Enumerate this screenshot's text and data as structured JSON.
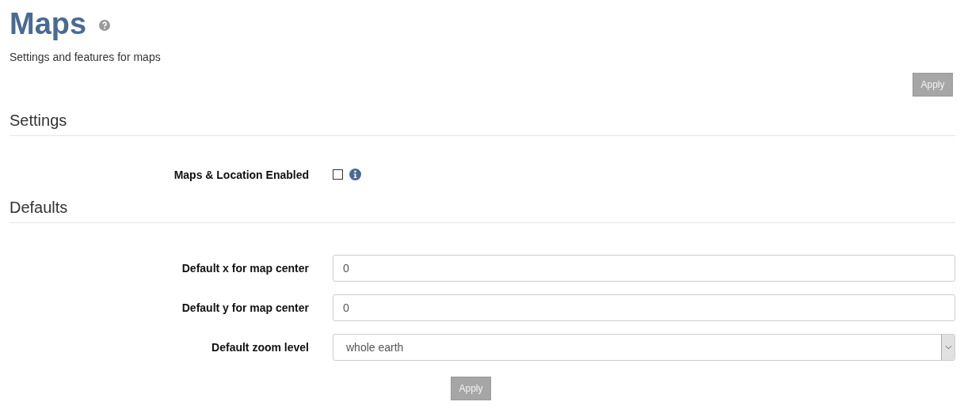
{
  "title": "Maps",
  "subtitle": "Settings and features for maps",
  "top_button": {
    "label": "Apply",
    "disabled": true
  },
  "sections": [
    {
      "heading": "Settings",
      "rows": [
        {
          "kind": "checkbox",
          "label": "Maps & Location Enabled",
          "checked": false
        }
      ]
    },
    {
      "heading": "Defaults",
      "rows": [
        {
          "kind": "text",
          "label": "Default x for map center",
          "value": "0"
        },
        {
          "kind": "text",
          "label": "Default y for map center",
          "value": "0"
        },
        {
          "kind": "select",
          "label": "Default zoom level",
          "value": "whole earth"
        }
      ]
    }
  ],
  "bottom_button": {
    "label": "Apply",
    "disabled": true
  }
}
